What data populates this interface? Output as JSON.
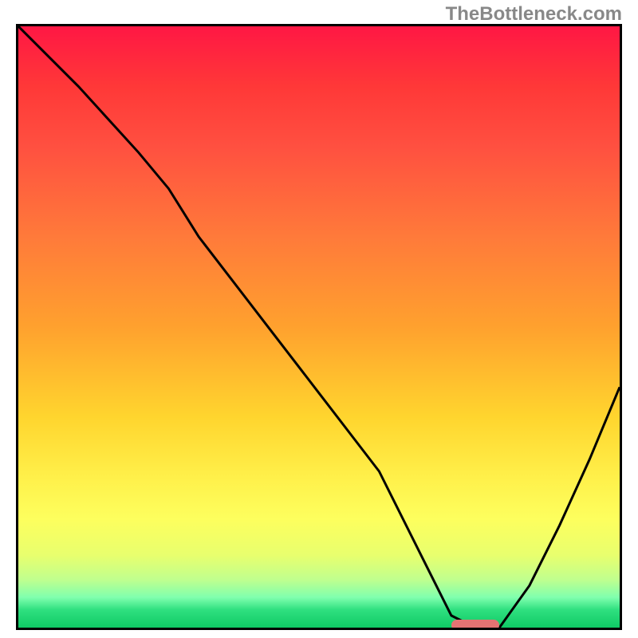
{
  "watermark": "TheBottleneck.com",
  "chart_data": {
    "type": "line",
    "title": "",
    "xlabel": "",
    "ylabel": "",
    "xlim": [
      0,
      100
    ],
    "ylim": [
      0,
      100
    ],
    "x": [
      0,
      10,
      20,
      25,
      30,
      40,
      50,
      60,
      68,
      72,
      76,
      80,
      85,
      90,
      95,
      100
    ],
    "y": [
      100,
      90,
      79,
      73,
      65,
      52,
      39,
      26,
      10,
      2,
      0,
      0,
      7,
      17,
      28,
      40
    ],
    "optimal_marker": {
      "x_start": 72,
      "x_end": 80,
      "y": 0,
      "color": "#e57373"
    }
  }
}
